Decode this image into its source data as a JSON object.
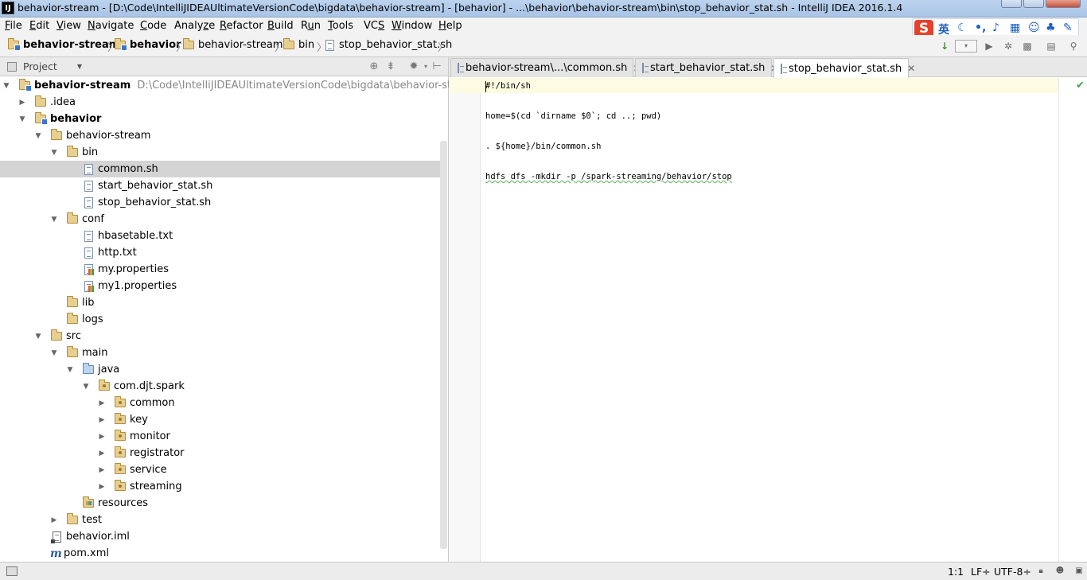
{
  "window": {
    "app_icon": "IJ",
    "title": "behavior-stream - [D:\\Code\\IntelliJIDEAUltimateVersionCode\\bigdata\\behavior-stream] - [behavior] - ...\\behavior\\behavior-stream\\bin\\stop_behavior_stat.sh - IntelliJ IDEA 2016.1.4"
  },
  "menu": [
    {
      "u": "F",
      "rest": "ile"
    },
    {
      "u": "E",
      "rest": "dit"
    },
    {
      "u": "V",
      "rest": "iew"
    },
    {
      "u": "N",
      "rest": "avigate"
    },
    {
      "u": "C",
      "rest": "ode"
    },
    {
      "pre": "Analy",
      "u": "z",
      "rest": "e"
    },
    {
      "u": "R",
      "rest": "efactor"
    },
    {
      "u": "B",
      "rest": "uild"
    },
    {
      "pre": "R",
      "u": "u",
      "rest": "n"
    },
    {
      "u": "T",
      "rest": "ools"
    },
    {
      "pre": "VC",
      "u": "S",
      "rest": ""
    },
    {
      "u": "W",
      "rest": "indow"
    },
    {
      "u": "H",
      "rest": "elp"
    }
  ],
  "ime": {
    "logo": "S",
    "lang": "英"
  },
  "breadcrumbs": [
    "behavior-stream",
    "behavior",
    "behavior-stream",
    "bin",
    "stop_behavior_stat.sh"
  ],
  "project_panel": {
    "view_label": "Project"
  },
  "tree": [
    {
      "label": "behavior-stream",
      "path": "D:\\Code\\IntelliJIDEAUltimateVersionCode\\bigdata\\behavior-stream"
    },
    {
      "label": ".idea"
    },
    {
      "label": "behavior"
    },
    {
      "label": "behavior-stream"
    },
    {
      "label": "bin"
    },
    {
      "label": "common.sh"
    },
    {
      "label": "start_behavior_stat.sh"
    },
    {
      "label": "stop_behavior_stat.sh"
    },
    {
      "label": "conf"
    },
    {
      "label": "hbasetable.txt"
    },
    {
      "label": "http.txt"
    },
    {
      "label": "my.properties"
    },
    {
      "label": "my1.properties"
    },
    {
      "label": "lib"
    },
    {
      "label": "logs"
    },
    {
      "label": "src"
    },
    {
      "label": "main"
    },
    {
      "label": "java"
    },
    {
      "label": "com.djt.spark"
    },
    {
      "label": "common"
    },
    {
      "label": "key"
    },
    {
      "label": "monitor"
    },
    {
      "label": "registrator"
    },
    {
      "label": "service"
    },
    {
      "label": "streaming"
    },
    {
      "label": "resources"
    },
    {
      "label": "test"
    },
    {
      "label": "behavior.iml"
    },
    {
      "label": "pom.xml"
    }
  ],
  "tabs": [
    {
      "label": "behavior-stream\\...\\common.sh"
    },
    {
      "label": "start_behavior_stat.sh"
    },
    {
      "label": "stop_behavior_stat.sh",
      "active": true
    }
  ],
  "code": [
    "#!/bin/sh",
    "home=$(cd `dirname $0`; cd ..; pwd)",
    ". ${home}/bin/common.sh",
    "hdfs dfs -mkdir -p /spark-streaming/behavior/stop"
  ],
  "status": {
    "position": "1:1",
    "line_sep": "LF÷",
    "encoding": "UTF-8÷"
  }
}
